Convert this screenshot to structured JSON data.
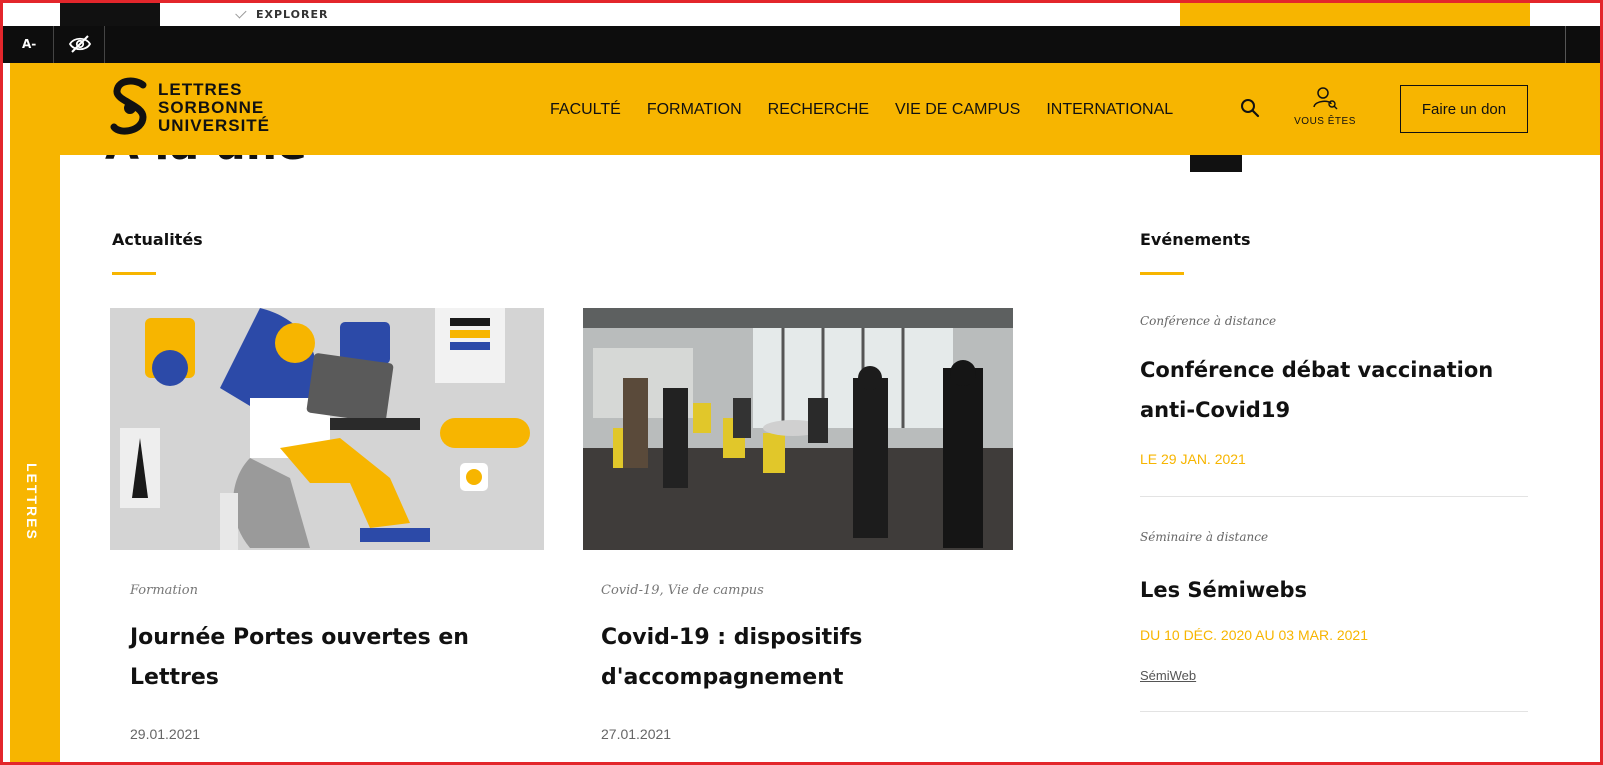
{
  "topbar": {
    "explorer_label": "EXPLORER"
  },
  "accessibility": {
    "font_decrease_label": "A-",
    "hide_icon": "eye-slash-icon"
  },
  "sidebar": {
    "label": "LETTRES"
  },
  "header": {
    "logo": {
      "line1": "LETTRES",
      "line2": "SORBONNE",
      "line3": "UNIVERSITÉ"
    },
    "nav": [
      "FACULTÉ",
      "FORMATION",
      "RECHERCHE",
      "VIE DE CAMPUS",
      "INTERNATIONAL"
    ],
    "vous_etes_label": "VOUS ÊTES",
    "donate_label": "Faire un don",
    "search_icon": "search-icon",
    "user_icon": "user-search-icon"
  },
  "page": {
    "title_partial": "À la une"
  },
  "news": {
    "title": "Actualités",
    "items": [
      {
        "category": "Formation",
        "title_line1": "Journée Portes ouvertes en",
        "title_line2": "Lettres",
        "date": "29.01.2021"
      },
      {
        "category": "Covid-19, Vie de campus",
        "title_line1": "Covid-19 : dispositifs",
        "title_line2": "d'accompagnement",
        "date": "27.01.2021"
      }
    ]
  },
  "events": {
    "title": "Evénements",
    "items": [
      {
        "category": "Conférence à distance",
        "title_line1": "Conférence débat vaccination",
        "title_line2": "anti-Covid19",
        "date": "LE 29 JAN. 2021"
      },
      {
        "category": "Séminaire à distance",
        "title_line1": "Les Sémiwebs",
        "date": "DU 10 DÉC. 2020 AU 03 MAR. 2021",
        "link": "SémiWeb"
      }
    ]
  },
  "colors": {
    "brand_yellow": "#f7b500",
    "frame_red": "#e3262b",
    "dark": "#0d0d0d"
  }
}
